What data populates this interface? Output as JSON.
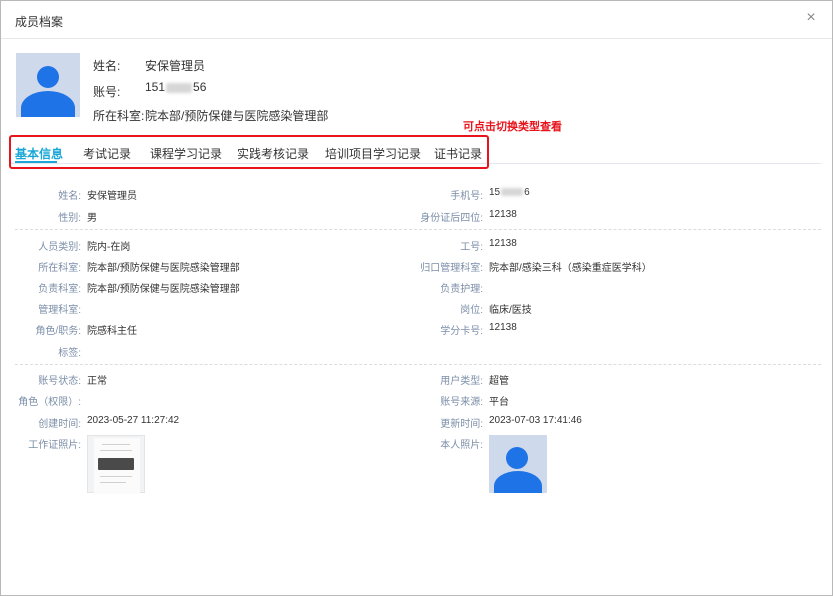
{
  "dialog": {
    "title": "成员档案",
    "close_icon": "×"
  },
  "profile": {
    "name_label": "姓名:",
    "name": "安保管理员",
    "account_label": "账号:",
    "account_prefix": "151",
    "account_suffix": "56",
    "dept_label": "所在科室:",
    "dept": "院本部/预防保健与医院感染管理部"
  },
  "hint": "可点击切换类型查看",
  "tabs": [
    {
      "label": "基本信息",
      "active": true
    },
    {
      "label": "考试记录",
      "active": false
    },
    {
      "label": "课程学习记录",
      "active": false
    },
    {
      "label": "实践考核记录",
      "active": false
    },
    {
      "label": "培训项目学习记录",
      "active": false
    },
    {
      "label": "证书记录",
      "active": false
    }
  ],
  "basic": {
    "name_l": "姓名:",
    "name_v": "安保管理员",
    "phone_l": "手机号:",
    "phone_prefix": "15",
    "phone_suffix": "6",
    "gender_l": "性别:",
    "gender_v": "男",
    "id_l": "身份证后四位:",
    "id_v": "12138"
  },
  "work": {
    "type_l": "人员类别:",
    "type_v": "院内-在岗",
    "no_l": "工号:",
    "no_v": "12138",
    "dept_l": "所在科室:",
    "dept_v": "院本部/预防保健与医院感染管理部",
    "home_l": "归口管理科室:",
    "home_v": "院本部/感染三科（感染重症医学科）",
    "resp_l": "负责科室:",
    "resp_v": "院本部/预防保健与医院感染管理部",
    "nurse_l": "负责护理:",
    "nurse_v": "",
    "mgmt_l": "管理科室:",
    "mgmt_v": "",
    "post_l": "岗位:",
    "post_v": "临床/医技",
    "role_l": "角色/职务:",
    "role_v": "院感科主任",
    "credit_l": "学分卡号:",
    "credit_v": "12138",
    "tag_l": "标签:",
    "tag_v": ""
  },
  "account": {
    "status_l": "账号状态:",
    "status_v": "正常",
    "utype_l": "用户类型:",
    "utype_v": "超管",
    "perm_l": "角色（权限）:",
    "perm_v": "",
    "src_l": "账号来源:",
    "src_v": "平台",
    "created_l": "创建时间:",
    "created_v": "2023-05-27 11:27:42",
    "updated_l": "更新时间:",
    "updated_v": "2023-07-03 17:41:46",
    "workphoto_l": "工作证照片:",
    "photo_l": "本人照片:"
  },
  "colors": {
    "accent": "#1aa7d8",
    "highlight": "#e8141c",
    "avatar_blue": "#1e73e6"
  }
}
